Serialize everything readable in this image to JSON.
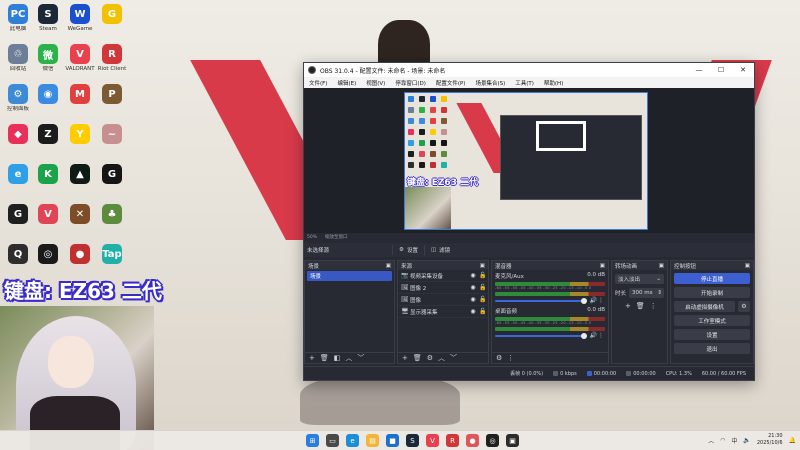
{
  "desktop": {
    "icons": [
      {
        "label": "此电脑",
        "glyph": "PC",
        "color": "#2f7fd8"
      },
      {
        "label": "Steam",
        "glyph": "S",
        "color": "#1b2838"
      },
      {
        "label": "WeGame",
        "glyph": "W",
        "color": "#1a4fd0"
      },
      {
        "label": "",
        "glyph": "G",
        "color": "#f2c200"
      },
      {
        "label": "回收站",
        "glyph": "♲",
        "color": "#6d7f98"
      },
      {
        "label": "微信",
        "glyph": "微",
        "color": "#2ab34a"
      },
      {
        "label": "VALORANT",
        "glyph": "V",
        "color": "#e9404f"
      },
      {
        "label": "Riot Client",
        "glyph": "R",
        "color": "#d13639"
      },
      {
        "label": "控制面板",
        "glyph": "⚙",
        "color": "#3d8ad6"
      },
      {
        "label": "",
        "glyph": "◉",
        "color": "#3b8be0"
      },
      {
        "label": "",
        "glyph": "M",
        "color": "#e2403f"
      },
      {
        "label": "",
        "glyph": "P",
        "color": "#7b5a34"
      },
      {
        "label": "",
        "glyph": "◆",
        "color": "#e8305a"
      },
      {
        "label": "",
        "glyph": "Z",
        "color": "#1c1c1c"
      },
      {
        "label": "",
        "glyph": "Y",
        "color": "#ffcc00"
      },
      {
        "label": "",
        "glyph": "~",
        "color": "#c78f8f"
      },
      {
        "label": "",
        "glyph": "e",
        "color": "#2fa0e8"
      },
      {
        "label": "",
        "glyph": "K",
        "color": "#1aa34a"
      },
      {
        "label": "",
        "glyph": "▲",
        "color": "#0e1a14"
      },
      {
        "label": "",
        "glyph": "G",
        "color": "#151515"
      },
      {
        "label": "",
        "glyph": "G",
        "color": "#1f1f1f"
      },
      {
        "label": "",
        "glyph": "V",
        "color": "#e14555"
      },
      {
        "label": "",
        "glyph": "✕",
        "color": "#7d4d2a"
      },
      {
        "label": "",
        "glyph": "♣",
        "color": "#5c8c3c"
      },
      {
        "label": "",
        "glyph": "Q",
        "color": "#2d2d2d"
      },
      {
        "label": "",
        "glyph": "◎",
        "color": "#1a1a1a"
      },
      {
        "label": "",
        "glyph": "●",
        "color": "#c0302f"
      },
      {
        "label": "",
        "glyph": "Tap",
        "color": "#1fb0a8"
      }
    ],
    "keyboard_banner": "键盘: EZ63 二代"
  },
  "obs": {
    "title": "OBS 31.0.4 - 配置文件: 未命名 - 场景: 未命名",
    "window_controls": {
      "minimize": "—",
      "maximize": "☐",
      "close": "✕"
    },
    "menu": [
      "文件(F)",
      "编辑(E)",
      "视图(V)",
      "停靠窗口(D)",
      "配置文件(P)",
      "场景集合(S)",
      "工具(T)",
      "帮助(H)"
    ],
    "zoom_row": {
      "zoom": "50%",
      "mode": "缩放至窗口"
    },
    "source_toolbar": {
      "no_source": "未选择源",
      "properties": "设置",
      "filters": "滤镜"
    },
    "scenes": {
      "title": "场景",
      "items": [
        "场景"
      ]
    },
    "sources": {
      "title": "来源",
      "items": [
        {
          "name": "视频采集设备",
          "icon": "📷"
        },
        {
          "name": "图像 2",
          "icon": "🖼"
        },
        {
          "name": "图像",
          "icon": "🖼"
        },
        {
          "name": "显示器采集",
          "icon": "🖥"
        }
      ]
    },
    "mixer": {
      "title": "混音器",
      "channels": [
        {
          "name": "麦克风/Aux",
          "db": "0.0 dB"
        },
        {
          "name": "桌面音频",
          "db": "0.0 dB"
        }
      ],
      "ticks": "-60 -55 -50 -45 -40 -35 -30 -25 -20 -15 -10 -5 0"
    },
    "transitions": {
      "title": "转场动画",
      "selected": "淡入淡出",
      "duration_label": "时长",
      "duration": "300 ms"
    },
    "controls": {
      "title": "控制按钮",
      "start_stream": "停止直播",
      "start_record": "开始录制",
      "virtual_cam": "启动虚拟摄像机",
      "studio_mode": "工作室模式",
      "settings": "设置",
      "exit": "退出"
    },
    "status": {
      "frames": "丢帧 0 (0.0%)",
      "bitrate": "0 kbps",
      "stream_time": "00:00:00",
      "record_time": "00:00:00",
      "cpu": "CPU: 1.3%",
      "fps": "60.00 / 60.00 FPS"
    }
  },
  "taskbar": {
    "apps": [
      {
        "glyph": "⊞",
        "color": "#2a7de1"
      },
      {
        "glyph": "▭",
        "color": "#4a4a4a"
      },
      {
        "glyph": "e",
        "color": "#1a8fd6"
      },
      {
        "glyph": "▤",
        "color": "#f2b53a"
      },
      {
        "glyph": "■",
        "color": "#1a6fd0"
      },
      {
        "glyph": "S",
        "color": "#1b2838"
      },
      {
        "glyph": "V",
        "color": "#e9404f"
      },
      {
        "glyph": "R",
        "color": "#d13639"
      },
      {
        "glyph": "●",
        "color": "#e0555a"
      },
      {
        "glyph": "◎",
        "color": "#202020"
      },
      {
        "glyph": "▣",
        "color": "#2b2b2b"
      }
    ],
    "tray": {
      "time": "21:30",
      "date": "2025/10/6",
      "ime": "中"
    }
  }
}
